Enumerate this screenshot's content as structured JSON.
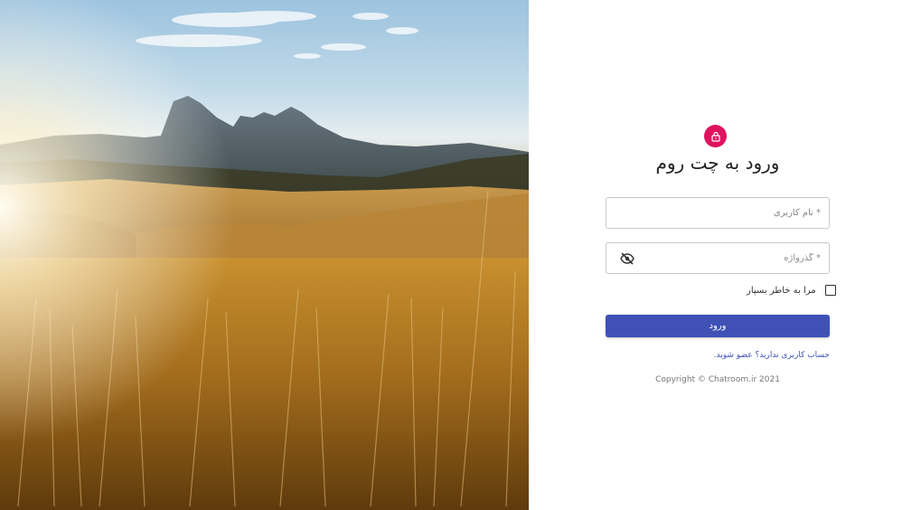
{
  "login": {
    "title": "ورود به چت روم",
    "username_placeholder": "* نام کاربری",
    "password_placeholder": "* گذرواژه",
    "remember_label": "مرا به خاطر بسپار",
    "submit_label": "ورود",
    "signup_link": "حساب کاربری ندارید؟ عضو شوید.",
    "copyright": "Copyright © Chatroom.ir 2021"
  },
  "icons": {
    "lock": "lock-icon",
    "password_toggle": "eye-off-icon"
  },
  "colors": {
    "accent": "#3f51b5",
    "badge": "#e0115f"
  }
}
